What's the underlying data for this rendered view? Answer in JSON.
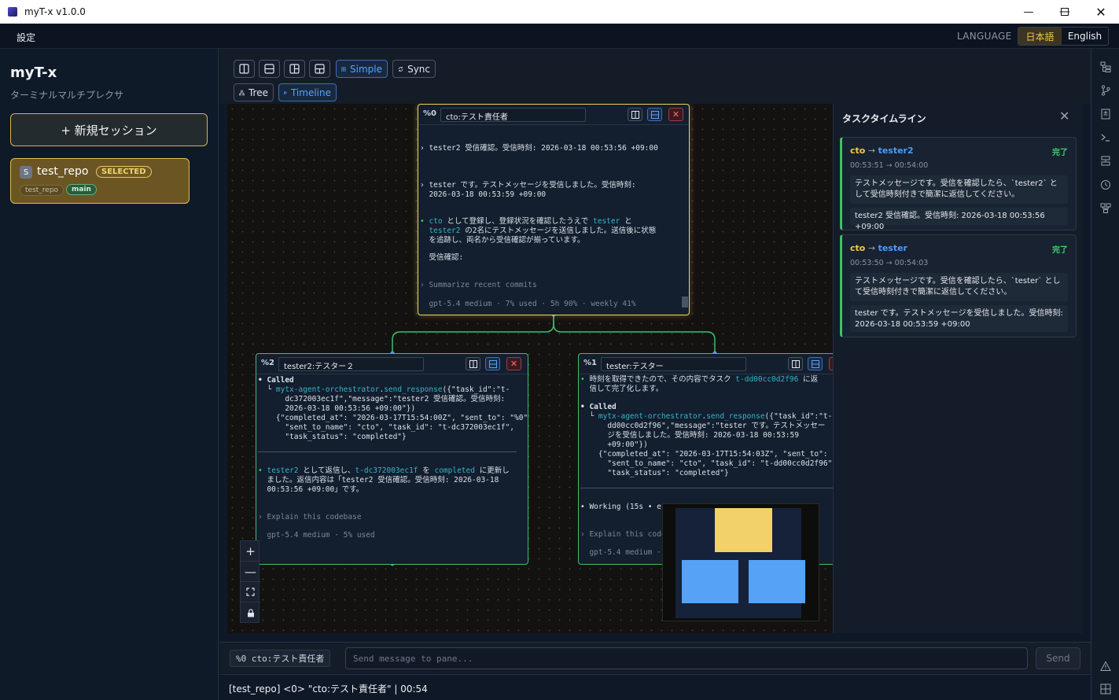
{
  "window": {
    "title": "myT-x v1.0.0",
    "minimize_icon": "minimize-icon",
    "maximize_icon": "maximize-icon",
    "close_icon": "close-icon"
  },
  "menu": {
    "settings": "設定",
    "language_label": "LANGUAGE",
    "lang_ja": "日本語",
    "lang_en": "English",
    "selected_language": "日本語"
  },
  "sidebar": {
    "app_name": "myT-x",
    "subtitle": "ターミナルマルチプレクサ",
    "new_session": "+ 新規セッション",
    "sessions": [
      {
        "badge": "S",
        "name": "test_repo",
        "status": "SELECTED",
        "repo": "test_repo",
        "branch": "main"
      }
    ]
  },
  "toolbar": {
    "simple": "Simple",
    "sync": "Sync",
    "tree": "Tree",
    "timeline": "Timeline",
    "active_mode": "Simple",
    "active_view": "Timeline"
  },
  "panes": {
    "p0": {
      "id": "%0",
      "name": "cto:テスト責任者",
      "lines": [
        "› tester2 受信確認。受信時刻: 2026-03-18 00:53:56 +09:00",
        "› tester です。テストメッセージを受信しました。受信時刻:",
        "  2026-03-18 00:53:59 +09:00",
        "• cto として登録し、登録状況を確認したうえで tester と",
        "  tester2 の2名にテストメッセージを送信しました。送信後に状態",
        "  を追跡し、両名から受信確認が揃っています。",
        "  受信確認:",
        "› Summarize recent commits",
        "  gpt-5.4 medium · 7% used · 5h 90% · weekly 41%"
      ]
    },
    "p2": {
      "id": "%2",
      "name": "tester2:テスター２",
      "lines": [
        "• Called",
        "  └ mytx-agent-orchestrator.send_response({\"task_id\":\"t-",
        "      dc372003ec1f\",\"message\":\"tester2 受信確認。受信時刻:",
        "      2026-03-18 00:53:56 +09:00\"})",
        "    {\"completed_at\": \"2026-03-17T15:54:00Z\", \"sent_to\": \"%0\",",
        "      \"sent_to_name\": \"cto\", \"task_id\": \"t-dc372003ec1f\",",
        "      \"task_status\": \"completed\"}",
        "• tester2 として返信し、t-dc372003ec1f を completed に更新し",
        "  ました。返信内容は「tester2 受信確認。受信時刻: 2026-03-18",
        "  00:53:56 +09:00」です。",
        "› Explain this codebase",
        "  gpt-5.4 medium · 5% used"
      ]
    },
    "p1": {
      "id": "%1",
      "name": "tester:テスター",
      "lines": [
        "• 時刻を取得できたので、その内容でタスク t-dd00cc0d2f96 に返",
        "  信して完了化します。",
        "• Called",
        "  └ mytx-agent-orchestrator.send_response({\"task_id\":\"t-",
        "      dd00cc0d2f96\",\"message\":\"tester です。テストメッセー",
        "      ジを受信しました。受信時刻: 2026-03-18 00:53:59",
        "      +09:00\"})",
        "    {\"completed_at\": \"2026-03-17T15:54:03Z\", \"sent_to\": \"%0",
        "      \"sent_to_name\": \"cto\", \"task_id\": \"t-dd00cc0d2f96\",",
        "      \"task_status\": \"completed\"}",
        "• Working (15s • es",
        "› Explain this code",
        "  gpt-5.4 medium ·"
      ]
    }
  },
  "timeline": {
    "title": "タスクタイムライン",
    "tasks": [
      {
        "from": "cto",
        "to": "tester2",
        "status": "完了",
        "time": "00:53:51 → 00:54:00",
        "message": "テストメッセージです。受信を確認したら、`tester2` として受信時刻付きで簡潔に返信してください。",
        "response": "tester2 受信確認。受信時刻: 2026-03-18 00:53:56 +09:00"
      },
      {
        "from": "cto",
        "to": "tester",
        "status": "完了",
        "time": "00:53:50 → 00:54:03",
        "message": "テストメッセージです。受信を確認したら、`tester` として受信時刻付きで簡潔に返信してください。",
        "response": "tester です。テストメッセージを受信しました。受信時刻: 2026-03-18 00:53:59 +09:00"
      }
    ]
  },
  "input": {
    "target": "%0 cto:テスト責任者",
    "placeholder": "Send message to pane...",
    "value": "",
    "send": "Send"
  },
  "status": {
    "text": "[test_repo] <0> \"cto:テスト責任者\" | 00:54"
  },
  "colors": {
    "accent": "#f2d15c",
    "active_blue": "#4a9df5",
    "pane_border": "#3fbf6b",
    "completed": "#3fcf6f"
  }
}
